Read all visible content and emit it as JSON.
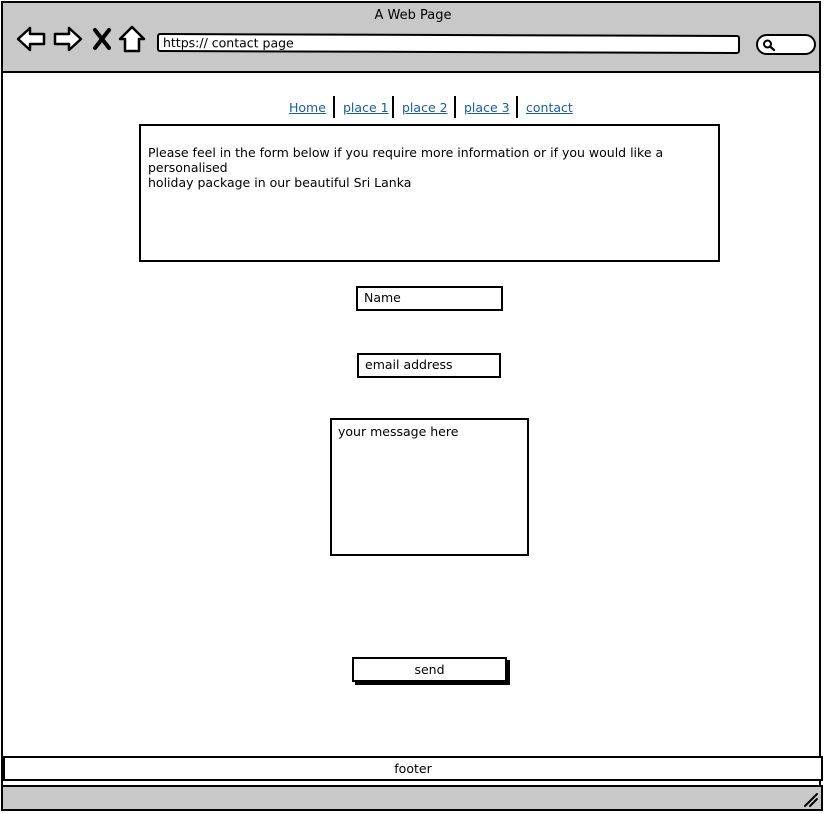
{
  "window": {
    "title": "A Web Page",
    "url": "https:// contact page"
  },
  "toolbar": {
    "icons": [
      "back-arrow-icon",
      "forward-arrow-icon",
      "close-x-icon",
      "home-icon",
      "search-icon"
    ]
  },
  "nav": {
    "links": [
      "Home",
      "place 1",
      "place 2",
      "place 3",
      "contact"
    ],
    "link_color": "#1d5f99"
  },
  "intro": {
    "line1": "Please feel in the form below if you require more information or if you would like a personalised",
    "line2": "holiday package in our beautiful Sri Lanka"
  },
  "form": {
    "name_placeholder": "Name",
    "email_placeholder": "email address",
    "message_placeholder": "your message here",
    "send_label": "send"
  },
  "footer": {
    "label": "footer"
  },
  "colors": {
    "chrome": "#c8c8c8",
    "background": "#ffffff",
    "stroke": "#000000"
  }
}
